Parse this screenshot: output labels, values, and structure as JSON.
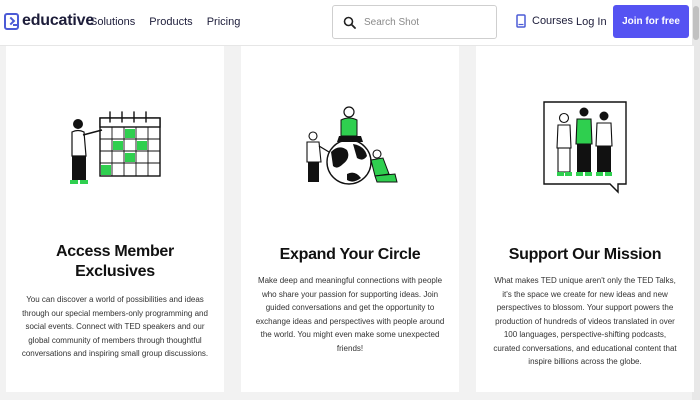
{
  "header": {
    "logo_text": "educative",
    "nav": [
      "Solutions",
      "Products",
      "Pricing"
    ],
    "search_placeholder": "Search Shot",
    "courses_label": "Courses",
    "login_label": "Log In",
    "join_label": "Join for free",
    "accent_color": "#5553f2"
  },
  "cards": [
    {
      "title": "Access Member Exclusives",
      "title_line1": "Access Member",
      "title_line2": "Exclusives",
      "body": "You can discover a world of possibilities and ideas through our special members-only programming and social events. Connect with TED speakers and our global community of members through thoughtful conversations and inspiring small group discussions.",
      "icon": "calendar-illustration"
    },
    {
      "title": "Expand Your Circle",
      "body": "Make deep and meaningful connections with people who share your passion for supporting ideas. Join guided conversations and get the opportunity to exchange ideas and perspectives with people around the world. You might even make some unexpected friends!",
      "icon": "globe-illustration"
    },
    {
      "title": "Support Our Mission",
      "body": "What makes TED unique aren't only the TED Talks, it's the space we create for new ideas and new perspectives to blossom. Your support powers the production of hundreds of videos translated in over 100 languages, perspective-shifting podcasts, curated conversations, and educational content that inspire billions across the globe.",
      "icon": "speech-bubble-illustration"
    }
  ],
  "illustration_accent": "#2fcf4f"
}
